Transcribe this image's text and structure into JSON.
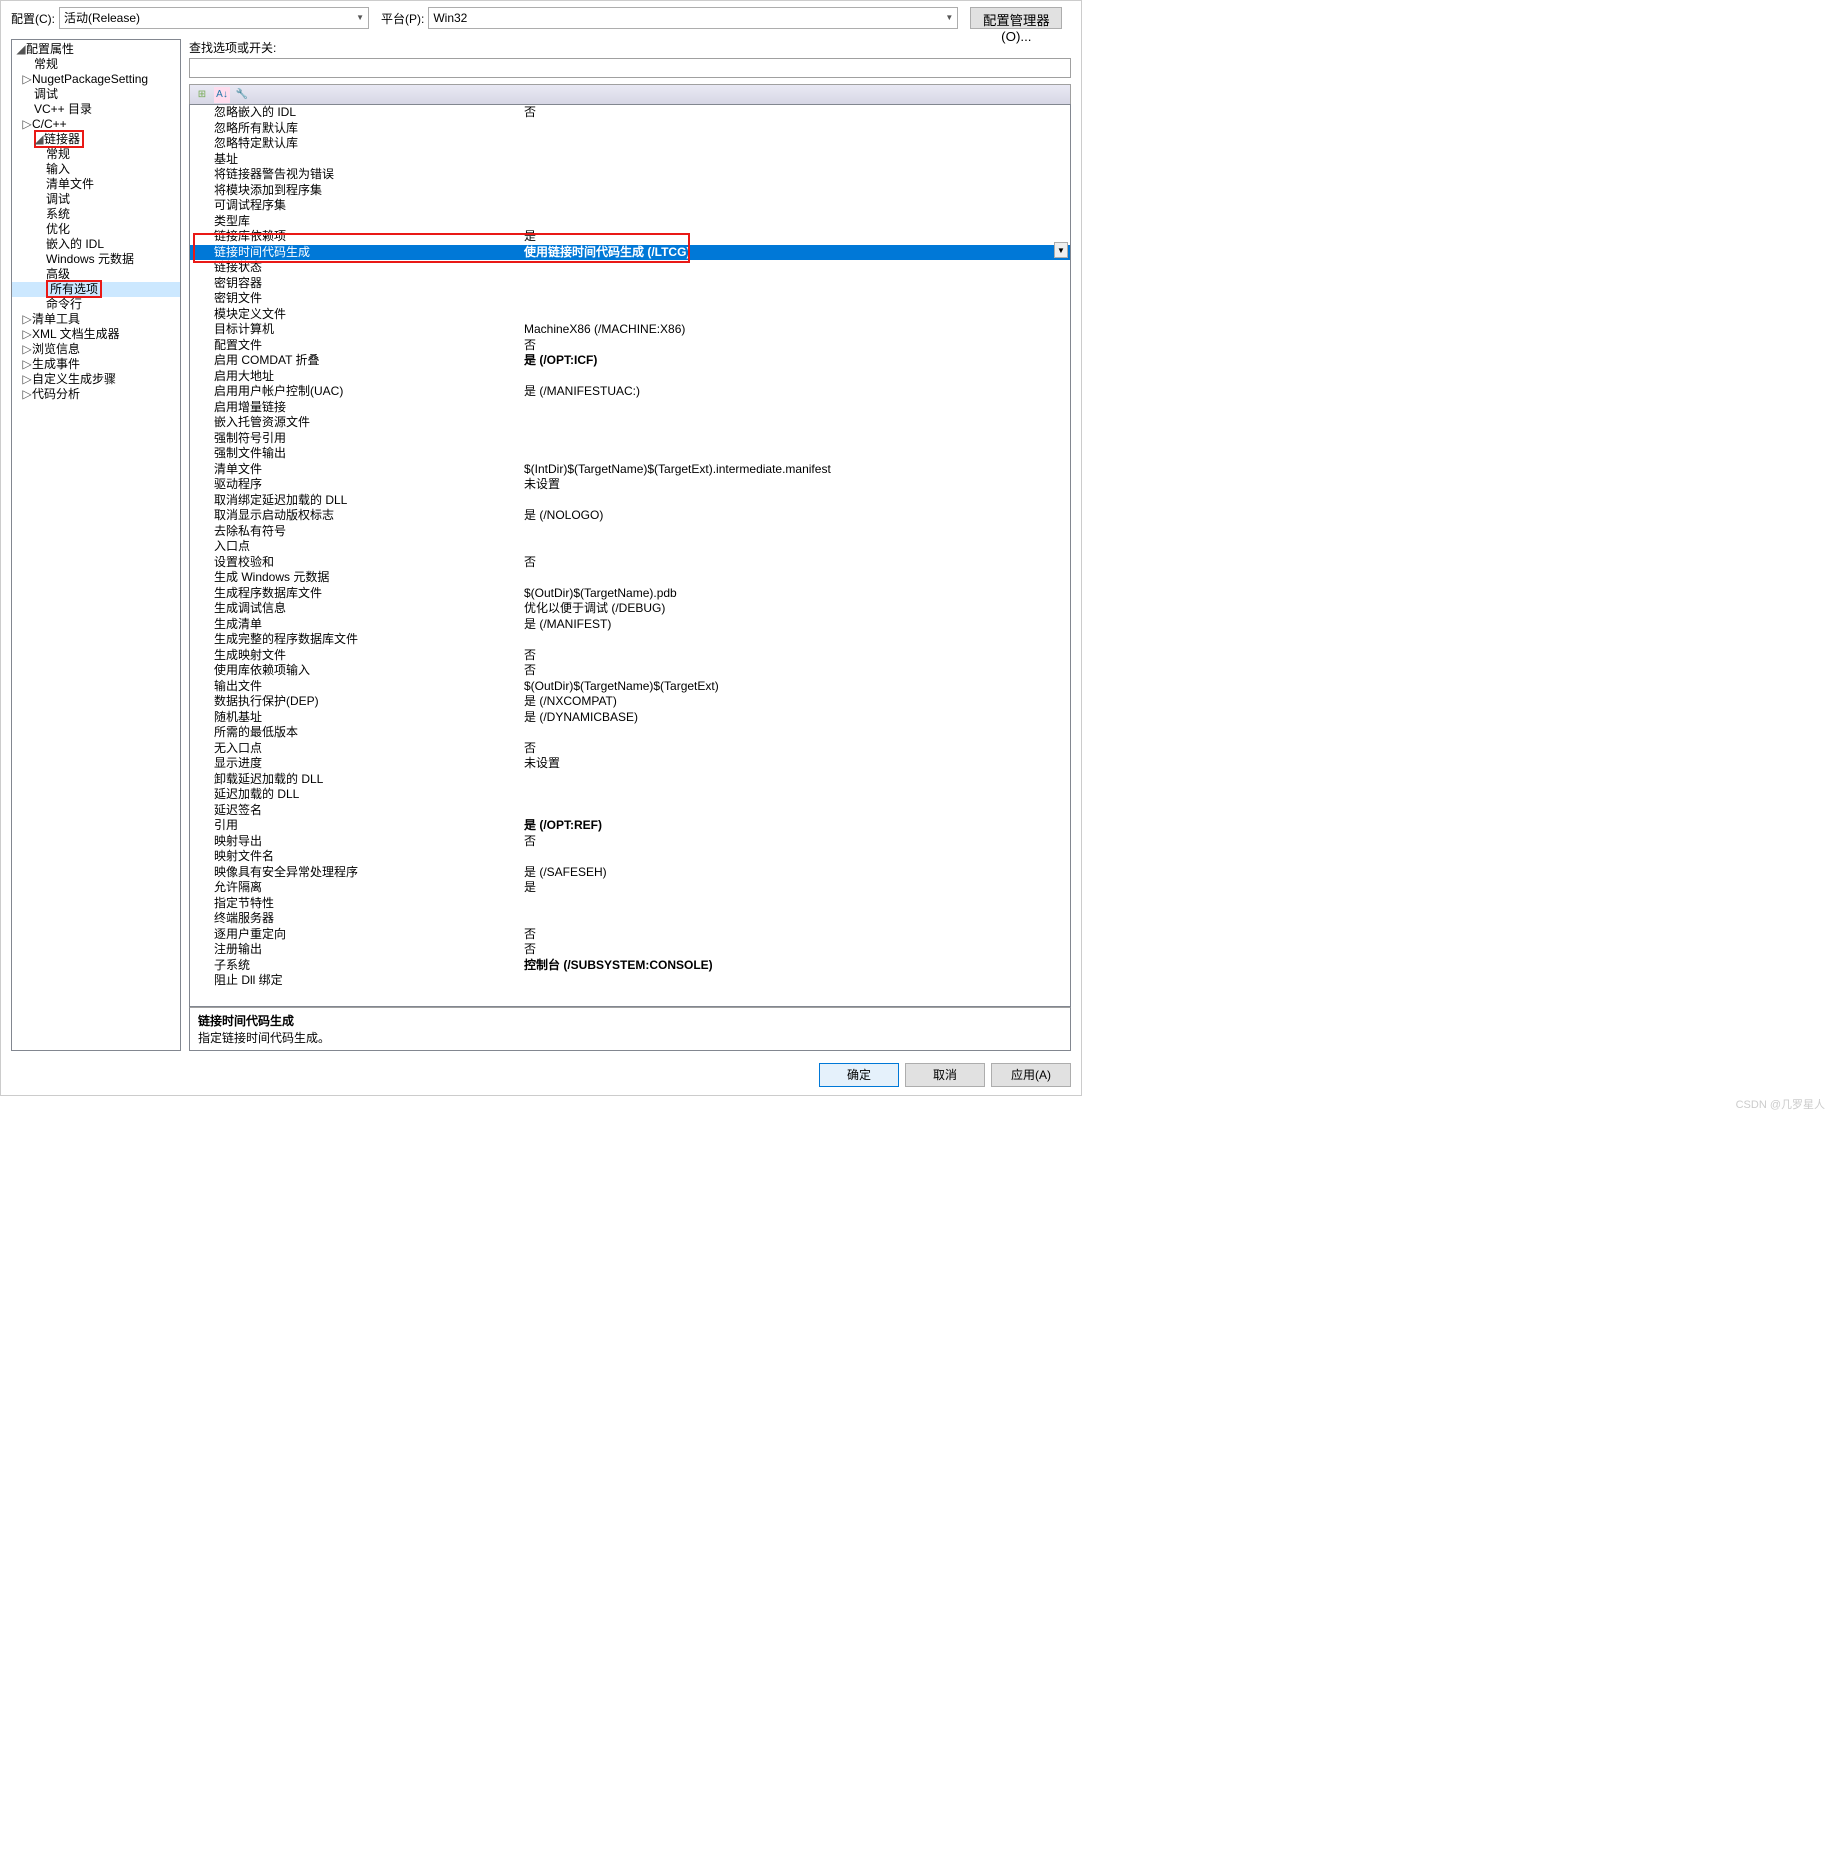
{
  "topbar": {
    "config_label": "配置(C):",
    "config_value": "活动(Release)",
    "platform_label": "平台(P):",
    "platform_value": "Win32",
    "cfg_mgr": "配置管理器(O)..."
  },
  "tree": {
    "root": "配置属性",
    "items": [
      "常规",
      "NugetPackageSetting",
      "调试",
      "VC++ 目录",
      "C/C++",
      "链接器",
      "常规",
      "输入",
      "清单文件",
      "调试",
      "系统",
      "优化",
      "嵌入的 IDL",
      "Windows 元数据",
      "高级",
      "所有选项",
      "命令行",
      "清单工具",
      "XML 文档生成器",
      "浏览信息",
      "生成事件",
      "自定义生成步骤",
      "代码分析"
    ]
  },
  "search": {
    "label": "查找选项或开关:"
  },
  "props": {
    "rows": [
      {
        "l": "忽略嵌入的 IDL",
        "v": "否"
      },
      {
        "l": "忽略所有默认库",
        "v": ""
      },
      {
        "l": "忽略特定默认库",
        "v": ""
      },
      {
        "l": "基址",
        "v": ""
      },
      {
        "l": "将链接器警告视为错误",
        "v": ""
      },
      {
        "l": "将模块添加到程序集",
        "v": ""
      },
      {
        "l": "可调试程序集",
        "v": ""
      },
      {
        "l": "类型库",
        "v": ""
      },
      {
        "l": "链接库依赖项",
        "v": "是"
      },
      {
        "l": "链接时间代码生成",
        "v": "使用链接时间代码生成 (/LTCG)",
        "sel": true
      },
      {
        "l": "链接状态",
        "v": ""
      },
      {
        "l": "密钥容器",
        "v": ""
      },
      {
        "l": "密钥文件",
        "v": ""
      },
      {
        "l": "模块定义文件",
        "v": ""
      },
      {
        "l": "目标计算机",
        "v": "MachineX86 (/MACHINE:X86)"
      },
      {
        "l": "配置文件",
        "v": "否"
      },
      {
        "l": "启用 COMDAT 折叠",
        "v": "是 (/OPT:ICF)",
        "b": true
      },
      {
        "l": "启用大地址",
        "v": ""
      },
      {
        "l": "启用用户帐户控制(UAC)",
        "v": "是 (/MANIFESTUAC:)"
      },
      {
        "l": "启用增量链接",
        "v": ""
      },
      {
        "l": "嵌入托管资源文件",
        "v": ""
      },
      {
        "l": "强制符号引用",
        "v": ""
      },
      {
        "l": "强制文件输出",
        "v": ""
      },
      {
        "l": "清单文件",
        "v": "$(IntDir)$(TargetName)$(TargetExt).intermediate.manifest"
      },
      {
        "l": "驱动程序",
        "v": "未设置"
      },
      {
        "l": "取消绑定延迟加载的 DLL",
        "v": ""
      },
      {
        "l": "取消显示启动版权标志",
        "v": "是 (/NOLOGO)"
      },
      {
        "l": "去除私有符号",
        "v": ""
      },
      {
        "l": "入口点",
        "v": ""
      },
      {
        "l": "设置校验和",
        "v": "否"
      },
      {
        "l": "生成 Windows 元数据",
        "v": ""
      },
      {
        "l": "生成程序数据库文件",
        "v": "$(OutDir)$(TargetName).pdb"
      },
      {
        "l": "生成调试信息",
        "v": "优化以便于调试 (/DEBUG)"
      },
      {
        "l": "生成清单",
        "v": "是 (/MANIFEST)"
      },
      {
        "l": "生成完整的程序数据库文件",
        "v": ""
      },
      {
        "l": "生成映射文件",
        "v": "否"
      },
      {
        "l": "使用库依赖项输入",
        "v": "否"
      },
      {
        "l": "输出文件",
        "v": "$(OutDir)$(TargetName)$(TargetExt)"
      },
      {
        "l": "数据执行保护(DEP)",
        "v": "是 (/NXCOMPAT)"
      },
      {
        "l": "随机基址",
        "v": "是 (/DYNAMICBASE)"
      },
      {
        "l": "所需的最低版本",
        "v": ""
      },
      {
        "l": "无入口点",
        "v": "否"
      },
      {
        "l": "显示进度",
        "v": "未设置"
      },
      {
        "l": "卸载延迟加载的 DLL",
        "v": ""
      },
      {
        "l": "延迟加载的 DLL",
        "v": ""
      },
      {
        "l": "延迟签名",
        "v": ""
      },
      {
        "l": "引用",
        "v": "是 (/OPT:REF)",
        "b": true
      },
      {
        "l": "映射导出",
        "v": "否"
      },
      {
        "l": "映射文件名",
        "v": ""
      },
      {
        "l": "映像具有安全异常处理程序",
        "v": "是 (/SAFESEH)"
      },
      {
        "l": "允许隔离",
        "v": "是"
      },
      {
        "l": "指定节特性",
        "v": ""
      },
      {
        "l": "终端服务器",
        "v": ""
      },
      {
        "l": "逐用户重定向",
        "v": "否"
      },
      {
        "l": "注册输出",
        "v": "否"
      },
      {
        "l": "子系统",
        "v": "控制台 (/SUBSYSTEM:CONSOLE)",
        "b": true
      },
      {
        "l": "阻止 Dll 绑定",
        "v": ""
      }
    ]
  },
  "desc": {
    "title": "链接时间代码生成",
    "body": "指定链接时间代码生成。"
  },
  "buttons": {
    "ok": "确定",
    "cancel": "取消",
    "apply": "应用(A)"
  },
  "watermark": "CSDN @几罗星人"
}
